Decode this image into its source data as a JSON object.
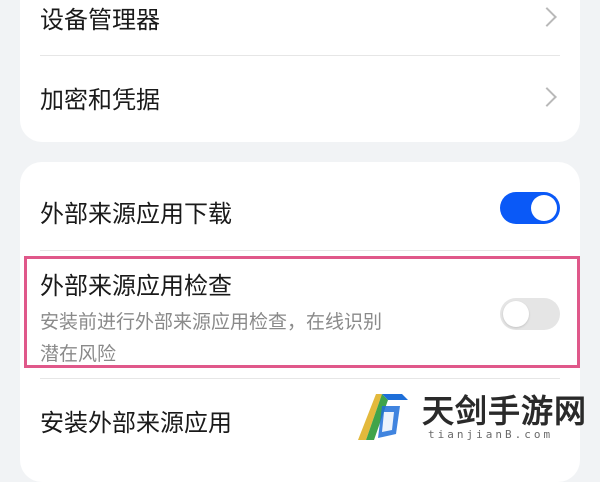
{
  "settings_top": {
    "items": [
      {
        "label": "设备管理器"
      },
      {
        "label": "加密和凭据"
      }
    ]
  },
  "settings_bottom": {
    "items": [
      {
        "label": "外部来源应用下载",
        "toggle": "on"
      },
      {
        "label": "外部来源应用检查",
        "sub_line1": "安装前进行外部来源应用检查，在线识别",
        "sub_line2": "潜在风险",
        "toggle": "off"
      },
      {
        "label": "安装外部来源应用"
      }
    ]
  },
  "colors": {
    "accent": "#0a59f7",
    "highlight_border": "#e0588a",
    "toggle_off": "#e5e5e5"
  },
  "watermark": {
    "title": "天剑手游网",
    "sub": "tianjianB.com"
  }
}
